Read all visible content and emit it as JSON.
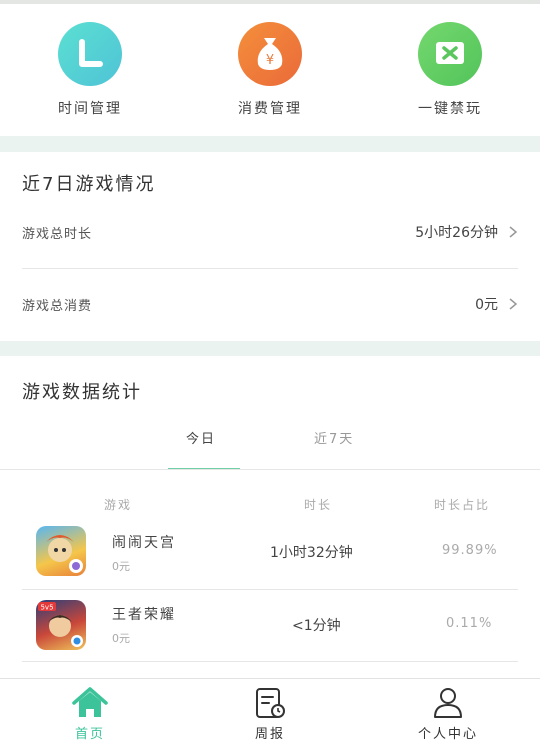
{
  "quick_actions": [
    {
      "label": "时间管理",
      "icon": "time-management-icon",
      "color": "#5fd6cf"
    },
    {
      "label": "消费管理",
      "icon": "money-bag-icon",
      "color": "#ef7e3a"
    },
    {
      "label": "一键禁玩",
      "icon": "block-play-icon",
      "color": "#66cf66"
    }
  ],
  "recent7": {
    "title": "近7日游戏情况",
    "rows": [
      {
        "label": "游戏总时长",
        "value": "5小时26分钟"
      },
      {
        "label": "游戏总消费",
        "value": "0元"
      }
    ]
  },
  "stats": {
    "title": "游戏数据统计",
    "tabs": [
      {
        "label": "今日",
        "active": true
      },
      {
        "label": "近7天",
        "active": false
      }
    ],
    "headers": {
      "game": "游戏",
      "duration": "时长",
      "share": "时长占比"
    },
    "games": [
      {
        "name": "闹闹天宫",
        "cost": "0元",
        "duration": "1小时32分钟",
        "share": "99.89%"
      },
      {
        "name": "王者荣耀",
        "cost": "0元",
        "duration": "<1分钟",
        "share": "0.11%"
      }
    ]
  },
  "nav": {
    "items": [
      {
        "label": "首页",
        "active": true
      },
      {
        "label": "周报",
        "active": false
      },
      {
        "label": "个人中心",
        "active": false
      }
    ]
  },
  "colors": {
    "accent": "#3cc39a",
    "bg": "#eaf3f0"
  }
}
